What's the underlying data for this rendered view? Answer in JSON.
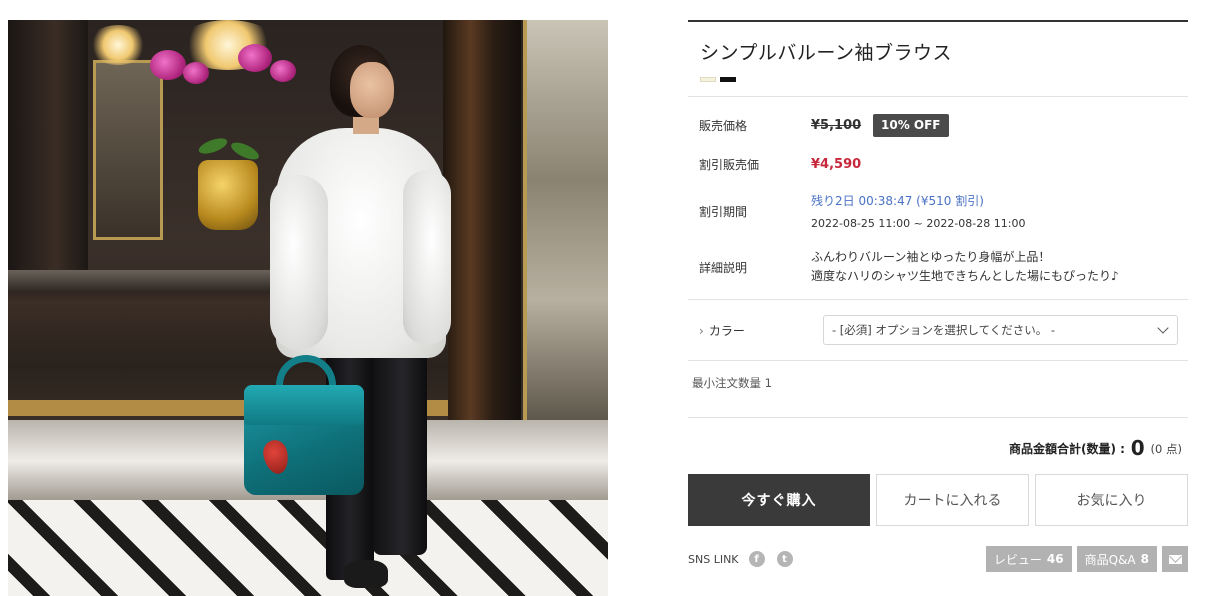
{
  "product": {
    "title": "シンプルバルーン袖ブラウス",
    "swatches": [
      "#f4f1dc",
      "#111111"
    ]
  },
  "price": {
    "list_label": "販売価格",
    "list_price": "¥5,100",
    "discount_badge": "10% OFF",
    "sale_label": "割引販売価",
    "sale_price": "¥4,590",
    "period_label": "割引期間",
    "period_remaining": "残り2日 00:38:47 (¥510 割引)",
    "period_range": "2022-08-25 11:00 ~ 2022-08-28 11:00",
    "desc_label": "詳細説明",
    "desc_line1": "ふんわりバルーン袖とゆったり身幅が上品！",
    "desc_line2": "適度なハリのシャツ生地できちんとした場にもぴったり♪"
  },
  "option": {
    "label": "カラー",
    "chevron": "›",
    "select_value": "- [必須] オプションを選択してください。 -"
  },
  "min_order": "最小注文数量 1",
  "total": {
    "label": "商品金額合計(数量) :",
    "amount": "0",
    "unit": "(0 点)"
  },
  "buttons": {
    "buy": "今すぐ購入",
    "cart": "カートに入れる",
    "favorite": "お気に入り"
  },
  "footer": {
    "sns_label": "SNS LINK",
    "facebook_glyph": "f",
    "twitter_glyph": "t",
    "review_label": "レビュー",
    "review_count": "46",
    "qa_label": "商品Q&A",
    "qa_count": "8"
  },
  "colors": {
    "sale_red": "#c8283c",
    "period_blue": "#4a72c5",
    "buy_button": "#3a3a3a",
    "tag_gray": "#b2b2b2"
  }
}
